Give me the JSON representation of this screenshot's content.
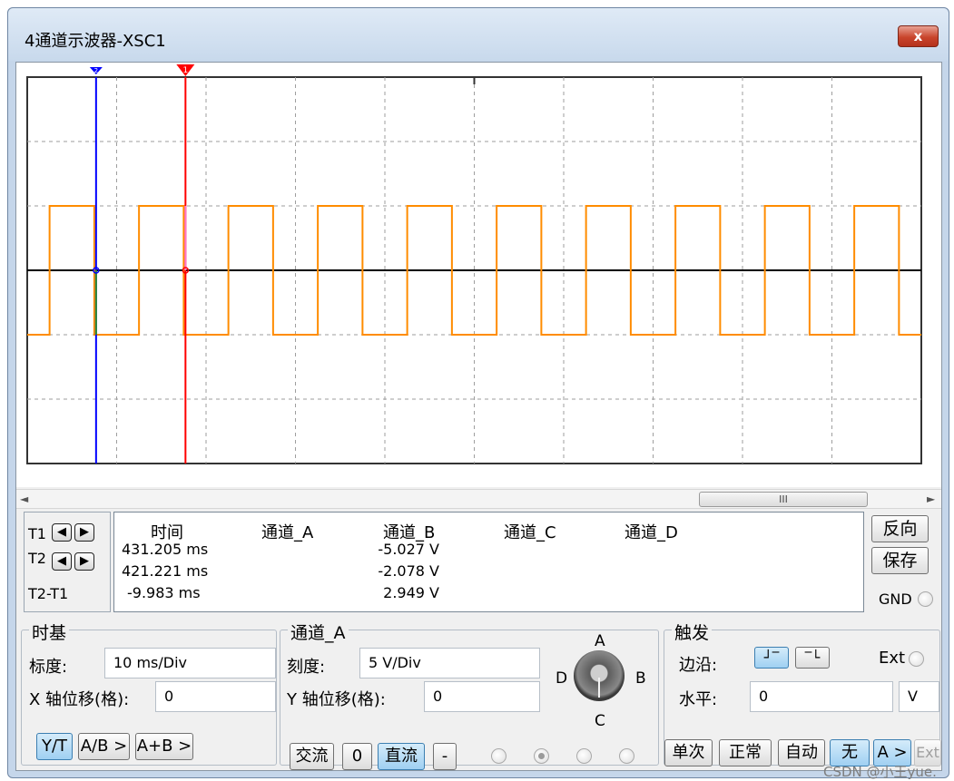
{
  "window": {
    "title": "4通道示波器-XSC1",
    "close_label": "x"
  },
  "scope": {
    "cursor_t1_marker": "1",
    "cursor_t2_marker": "2",
    "colors": {
      "background": "#ffffff",
      "grid": "#9e9e9e",
      "channel_b_trace": "#ff8c00",
      "channel_a_trace": "#000000",
      "cursor_1": "#ff0000",
      "cursor_2": "#0000ff"
    }
  },
  "scrollbar": {
    "left_arrow": "◄",
    "right_arrow": "►",
    "thumb_grip": "III"
  },
  "cursors": {
    "t1_label": "T1",
    "t2_label": "T2",
    "diff_label": "T2-T1",
    "left_arrow_icon": "arrow-left-icon",
    "right_arrow_icon": "arrow-right-icon"
  },
  "readout": {
    "headers": {
      "time": "时间",
      "channel_a": "通道_A",
      "channel_b": "通道_B",
      "channel_c": "通道_C",
      "channel_d": "通道_D"
    },
    "rows": [
      {
        "time": "431.205 ms",
        "channel_b": "-5.027 V"
      },
      {
        "time": "421.221 ms",
        "channel_b": "-2.078 V"
      },
      {
        "time": "-9.983 ms",
        "channel_b": "2.949 V"
      }
    ]
  },
  "side_buttons": {
    "reverse": "反向",
    "save": "保存",
    "gnd": "GND"
  },
  "timebase": {
    "title": "时基",
    "scale_label": "标度:",
    "scale_value": "10 ms/Div",
    "x_pos_label": "X 轴位移(格):",
    "x_pos_value": "0",
    "modes": [
      "Y/T",
      "A/B >",
      "A+B >"
    ],
    "active_mode": "Y/T"
  },
  "channel": {
    "title": "通道_A",
    "scale_label": "刻度:",
    "scale_value": "5  V/Div",
    "y_pos_label": "Y 轴位移(格):",
    "y_pos_value": "0",
    "coupling": [
      "交流",
      "0",
      "直流",
      "-"
    ],
    "active_coupling": "直流",
    "selector_labels": {
      "a": "A",
      "b": "B",
      "c": "C",
      "d": "D"
    },
    "selected_channel": "A"
  },
  "trigger": {
    "title": "触发",
    "edge_label": "边沿:",
    "ext_label": "Ext",
    "level_label": "水平:",
    "level_value": "0",
    "level_unit": "V",
    "modes": [
      "单次",
      "正常",
      "自动",
      "无"
    ],
    "active_mode": "无",
    "source_buttons": [
      "A >",
      "Ext"
    ],
    "active_source": "A >"
  },
  "watermark": "CSDN @小王yue."
}
